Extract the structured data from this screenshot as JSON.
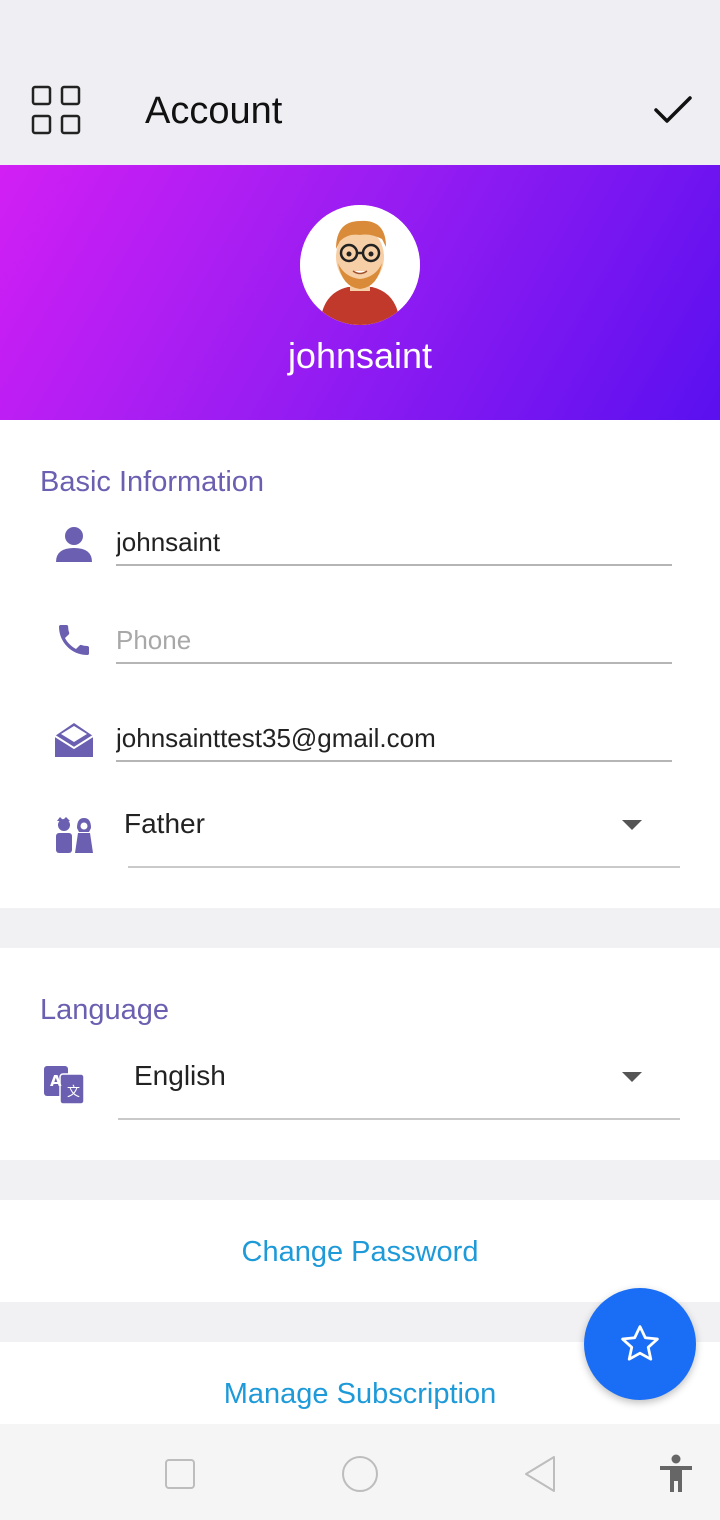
{
  "app_bar": {
    "title": "Account"
  },
  "profile": {
    "username": "johnsaint"
  },
  "basic_info": {
    "title": "Basic Information",
    "username_value": "johnsaint",
    "phone_placeholder": "Phone",
    "phone_value": "",
    "email_value": "johnsainttest35@gmail.com",
    "relation_selected": "Father"
  },
  "language": {
    "title": "Language",
    "selected": "English"
  },
  "actions": {
    "change_password": "Change Password",
    "manage_subscription": "Manage Subscription"
  },
  "colors": {
    "accent": "#6a5fb0",
    "link": "#1e9ad9",
    "fab": "#1a6ef5",
    "gradient_start": "#d21ff4",
    "gradient_end": "#5a10f0"
  },
  "icons": [
    "grid-menu-icon",
    "check-icon",
    "person-icon",
    "phone-icon",
    "mail-icon",
    "family-icon",
    "translate-icon",
    "star-icon",
    "nav-recents-icon",
    "nav-home-icon",
    "nav-back-icon",
    "accessibility-icon"
  ]
}
